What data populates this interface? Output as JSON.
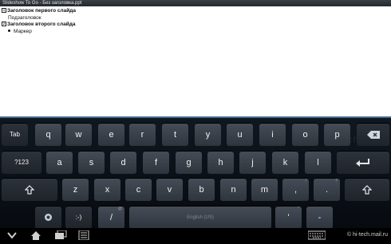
{
  "window": {
    "title": "Slideshow To Go - Без заголовка.ppt"
  },
  "outline": {
    "slides": [
      {
        "icon": "1",
        "title": "Заголовок первого слайда",
        "subtitle": "Подзаголовок"
      },
      {
        "icon": "2",
        "title": "Заголовок второго слайда",
        "bullet": "Маркер"
      }
    ]
  },
  "keyboard": {
    "row1": {
      "tab": "Tab",
      "keys": [
        "q",
        "w",
        "e",
        "r",
        "t",
        "y",
        "u",
        "i",
        "o",
        "p"
      ]
    },
    "row2": {
      "sym": "?123",
      "keys": [
        "a",
        "s",
        "d",
        "f",
        "g",
        "h",
        "j",
        "k",
        "l"
      ]
    },
    "row3": {
      "keys": [
        "z",
        "x",
        "c",
        "v",
        "b",
        "n",
        "m"
      ],
      "punct1": ",",
      "punct1_hint": "!",
      "punct2": ".",
      "punct2_hint": "?"
    },
    "row4": {
      "smiley": ":-)",
      "slash": "/",
      "slash_hint": "@",
      "apostrophe": "'",
      "apostrophe_hint": "\"",
      "dash": "-",
      "space_hint": "English (US)"
    },
    "watermark": "hi-tech"
  },
  "sysbar": {
    "credit": "© hi-tech.mail.ru"
  }
}
